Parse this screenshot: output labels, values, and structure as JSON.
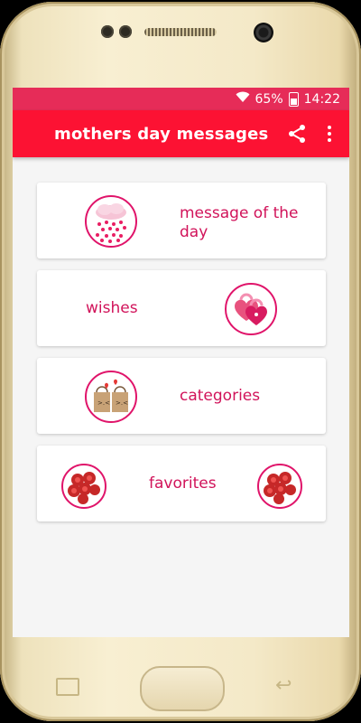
{
  "status_bar": {
    "battery": "65%",
    "time": "14:22"
  },
  "app_bar": {
    "title": "mothers day messages"
  },
  "cards": [
    {
      "label": "message of the day",
      "icon": "rain-of-hearts-icon"
    },
    {
      "label": "wishes",
      "icon": "heart-locks-icon"
    },
    {
      "label": "categories",
      "icon": "gift-bags-icon"
    },
    {
      "label": "favorites",
      "icon": "flower-bouquet-icon"
    }
  ],
  "colors": {
    "primary": "#fc1233",
    "status": "#e62c58",
    "accent": "#d1135a"
  }
}
